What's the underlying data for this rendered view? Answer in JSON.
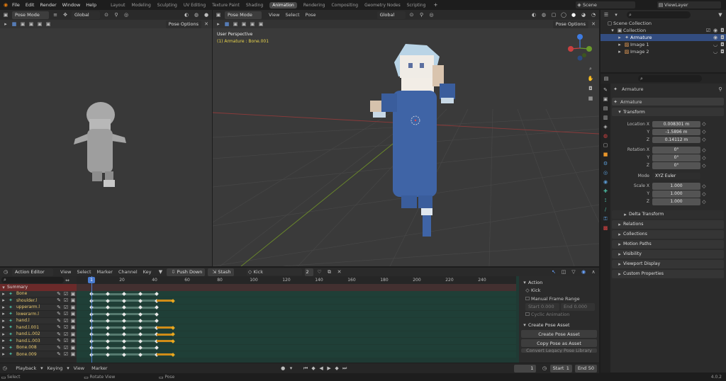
{
  "menu": [
    "File",
    "Edit",
    "Render",
    "Window",
    "Help"
  ],
  "workspaces": [
    "Layout",
    "Modeling",
    "Sculpting",
    "UV Editing",
    "Texture Paint",
    "Shading",
    "Animation",
    "Rendering",
    "Compositing",
    "Geometry Nodes",
    "Scripting"
  ],
  "active_workspace": "Animation",
  "scene": "Scene",
  "view_layer": "ViewLayer",
  "left_viewport": {
    "mode": "Pose Mode",
    "orientation": "Global",
    "options": "Pose Options"
  },
  "main_viewport": {
    "mode": "Pose Mode",
    "menus": [
      "View",
      "Select",
      "Pose"
    ],
    "orientation": "Global",
    "options": "Pose Options",
    "overlay_line1": "User Perspective",
    "overlay_line2": "(1) Armature : Bone.001"
  },
  "outliner": {
    "scene_collection": "Scene Collection",
    "collection": "Collection",
    "items": [
      "Armature",
      "Image 1",
      "Image 2"
    ]
  },
  "properties": {
    "object_name": "Armature",
    "data_name": "Armature",
    "transform": "Transform",
    "location": {
      "label": "Location X",
      "x": "0.008301 m",
      "y": "-1.5896 m",
      "z": "0.14112 m"
    },
    "rotation": {
      "label": "Rotation X",
      "x": "0°",
      "y": "0°",
      "z": "0°"
    },
    "mode": {
      "label": "Mode",
      "value": "XYZ Euler"
    },
    "scale": {
      "label": "Scale X",
      "x": "1.000",
      "y": "1.000",
      "z": "1.000"
    },
    "axis_y": "Y",
    "axis_z": "Z",
    "panels": [
      "Delta Transform",
      "Relations",
      "Collections",
      "Motion Paths",
      "Visibility",
      "Viewport Display",
      "Custom Properties"
    ]
  },
  "dopesheet": {
    "editor": "Action Editor",
    "menus": [
      "View",
      "Select",
      "Marker",
      "Channel",
      "Key"
    ],
    "push_down": "Push Down",
    "stash": "Stash",
    "action": "Kick",
    "users": "2",
    "frame_ticks": [
      "1",
      "20",
      "40",
      "60",
      "80",
      "100",
      "120",
      "140",
      "160",
      "180",
      "200",
      "220",
      "240"
    ],
    "current_frame": "1",
    "summary": "Summary",
    "channels": [
      "Bone",
      "shoulder.l",
      "upperarm.l",
      "lowerarm.l",
      "hand.l",
      "hand.l.001",
      "hand.L.002",
      "hand.L.003",
      "Bone.008",
      "Bone.009"
    ],
    "side_panel": {
      "action_title": "Action",
      "action_name": "Kick",
      "manual_frame_range": "Manual Frame Range",
      "start": "Start",
      "start_val": "0.000",
      "end": "End",
      "end_val": "0.000",
      "cyclic": "Cyclic Animation",
      "create_pose_asset": "Create Pose Asset",
      "create_btn": "Create Pose Asset",
      "copy_btn": "Copy Pose as Asset",
      "paste_btn": "Convert Legacy Pose Library"
    }
  },
  "timeline": {
    "menus": [
      "Playback",
      "Keying",
      "View",
      "Marker"
    ],
    "frame": "1",
    "start_label": "Start",
    "start": "1",
    "end_label": "End",
    "end": "50"
  },
  "statusbar": {
    "select": "Select",
    "rotate": "Rotate View",
    "pose": "Pose",
    "version": "4.0.2"
  }
}
